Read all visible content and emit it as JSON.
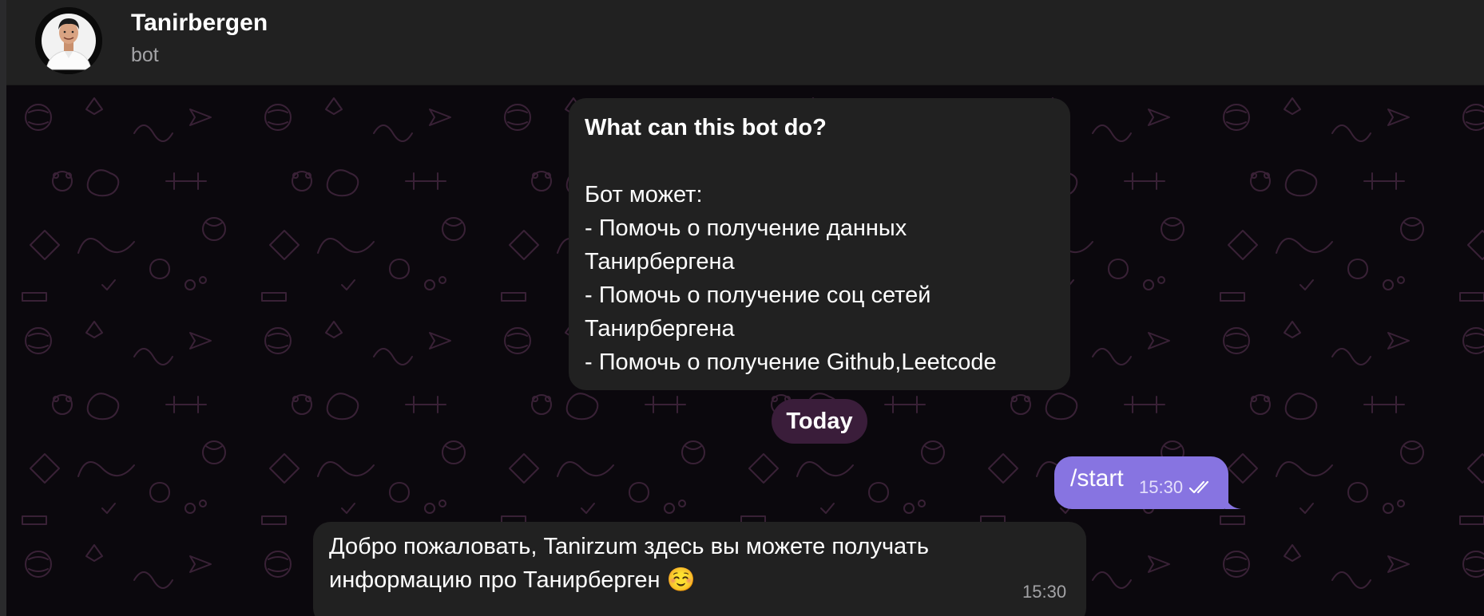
{
  "header": {
    "title": "Tanirbergen",
    "subtitle": "bot"
  },
  "info_card": {
    "title": "What can this bot do?",
    "lines": [
      "Бот может:",
      "- Помочь о получение данных",
      "Танирбергена",
      "- Помочь о получение соц сетей",
      "Танирбергена",
      "- Помочь о получение Github,Leetcode"
    ]
  },
  "date_separator": "Today",
  "messages": [
    {
      "direction": "outgoing",
      "lines": [
        "/start"
      ],
      "time": "15:30",
      "status": "read"
    },
    {
      "direction": "incoming",
      "lines": [
        "Добро пожаловать, Tanirzum здесь вы можете получать",
        "информацию про Танирберген ☺️"
      ],
      "time": "15:30"
    }
  ],
  "colors": {
    "header_bg": "#212121",
    "chat_bg": "#0b080d",
    "bubble_in": "#212121",
    "bubble_out": "#8774e1",
    "date_pill": "#3a1d3a",
    "pattern_stroke": "#3b2238"
  },
  "icons": {
    "read_status": "double-check-icon",
    "avatar": "profile-photo"
  }
}
